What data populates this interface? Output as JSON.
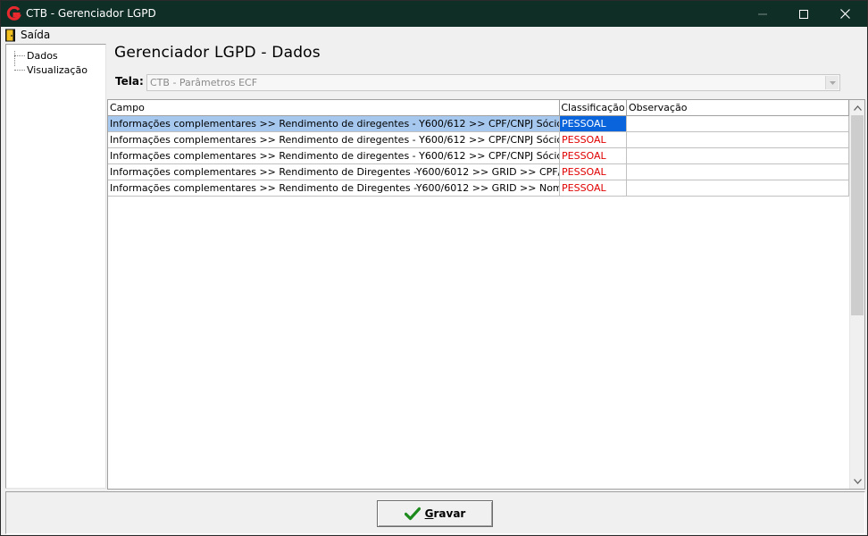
{
  "window": {
    "title": "CTB - Gerenciador LGPD"
  },
  "menu": {
    "items": [
      {
        "label": "Saída",
        "icon": "exit-door-icon"
      }
    ]
  },
  "tree": {
    "items": [
      {
        "label": "Dados"
      },
      {
        "label": "Visualização"
      }
    ]
  },
  "main": {
    "title": "Gerenciador LGPD - Dados",
    "tela_label": "Tela:",
    "tela_value": "CTB - Parâmetros ECF"
  },
  "grid": {
    "columns": [
      "Campo",
      "Classificação",
      "Observação"
    ],
    "rows": [
      {
        "campo": "Informações complementares >> Rendimento de diregentes - Y600/612 >> CPF/CNPJ Sócio Dirigente",
        "classificacao": "PESSOAL",
        "observacao": "",
        "selected": true
      },
      {
        "campo": "Informações complementares >> Rendimento de diregentes - Y600/612 >> CPF/CNPJ Sócio Dirigente >...",
        "classificacao": "PESSOAL",
        "observacao": ""
      },
      {
        "campo": "Informações complementares >> Rendimento de diregentes - Y600/612 >> CPF/CNPJ Sócio Dirigente >...",
        "classificacao": "PESSOAL",
        "observacao": ""
      },
      {
        "campo": "Informações complementares >> Rendimento de Diregentes -Y600/6012 >> GRID >> CPF/CNPJ",
        "classificacao": "PESSOAL",
        "observacao": ""
      },
      {
        "campo": "Informações complementares >> Rendimento de Diregentes -Y600/6012 >> GRID >> Nome/Razão Social",
        "classificacao": "PESSOAL",
        "observacao": ""
      }
    ]
  },
  "footer": {
    "save_label_underlined": "G",
    "save_label_rest": "ravar"
  },
  "colors": {
    "titlebar": "#0f2e26",
    "selection_row": "#a6c8ee",
    "selection_cell": "#0a64dc",
    "classification_text": "#e00000",
    "check_green": "#1c8a1c"
  }
}
